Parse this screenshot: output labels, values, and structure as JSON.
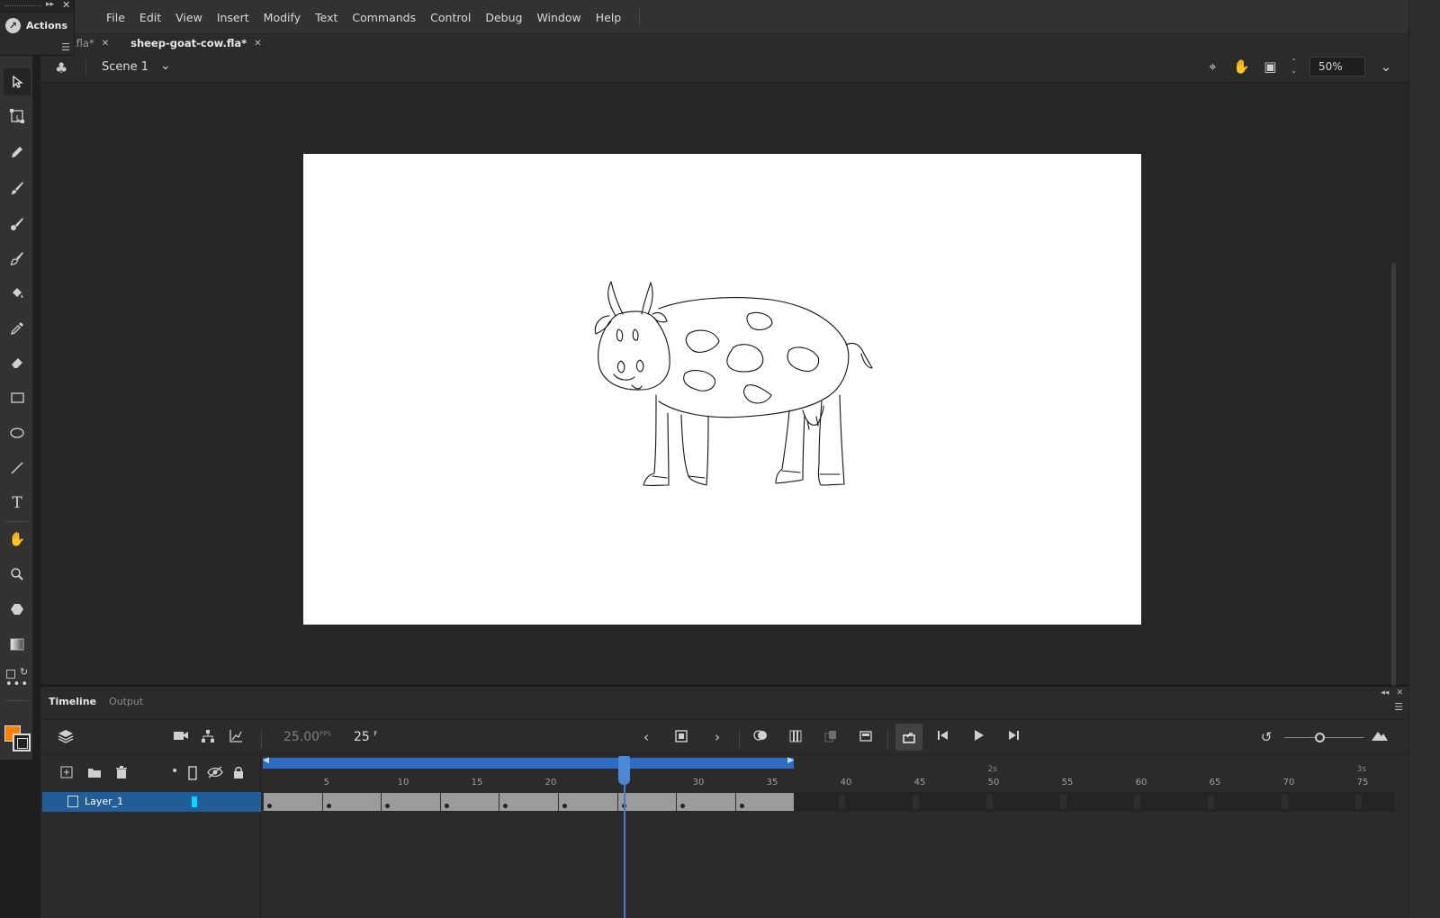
{
  "app": {
    "actions_panel_title": "Actions",
    "menu": [
      "File",
      "Edit",
      "View",
      "Insert",
      "Modify",
      "Text",
      "Commands",
      "Control",
      "Debug",
      "Window",
      "Help"
    ]
  },
  "doc_tabs": [
    {
      "label": ".fla*",
      "active": false
    },
    {
      "label": "sheep-goat-cow.fla*",
      "active": true
    }
  ],
  "edit_bar": {
    "scene": "Scene 1",
    "zoom": "50%"
  },
  "toolbar": {
    "tools": [
      "selection-tool",
      "free-transform-tool",
      "pencil-tool",
      "brush-tool",
      "paint-brush-tool",
      "fluid-brush-tool",
      "paint-bucket-tool",
      "eyedropper-tool",
      "eraser-tool",
      "rectangle-tool",
      "oval-tool",
      "line-tool",
      "text-tool",
      "hand-tool",
      "zoom-tool",
      "polystar-tool",
      "gradient-tool",
      "more-tools"
    ],
    "fill_color": "#ff8000",
    "stroke_color": "#ffffff"
  },
  "timeline": {
    "tabs": [
      "Timeline",
      "Output"
    ],
    "fps": "25.00",
    "fps_unit": "FPS",
    "current_frame": "25",
    "frame_unit": "F",
    "layer_name": "Layer_1",
    "layer_color": "#00d8ff",
    "ruler_labels": [
      "5",
      "10",
      "15",
      "20",
      "30",
      "35",
      "40",
      "45",
      "50",
      "55",
      "60",
      "65",
      "70",
      "75"
    ],
    "second_labels": [
      "2s",
      "3s"
    ],
    "selected_layer_color": "#235d98",
    "playhead_color": "#3c7fd6"
  }
}
